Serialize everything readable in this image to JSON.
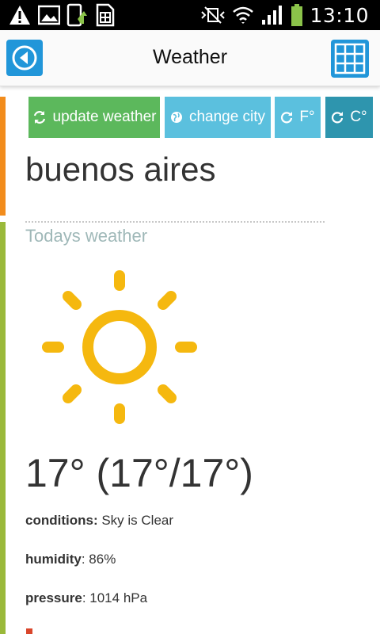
{
  "status_bar": {
    "time": "13:10",
    "left_icons": [
      "warning-icon",
      "image-icon",
      "phone-update-icon",
      "sim-card-icon"
    ],
    "right_icons": [
      "vibrate-off-icon",
      "wifi-icon",
      "signal-icon",
      "battery-icon"
    ],
    "battery_color": "#8bc34a"
  },
  "titlebar": {
    "title": "Weather",
    "back_icon": "back-arrow-icon",
    "menu_icon": "grid-icon",
    "accent": "#2196d9"
  },
  "actions": {
    "update_label": "update weather",
    "city_label": "change city",
    "f_label": "F°",
    "c_label": "C°"
  },
  "city": "buenos aires",
  "section_title": "Todays weather",
  "weather_icon": "sun-icon",
  "temperature": "17° (17°/17°)",
  "details": {
    "conditions_label": "conditions:",
    "conditions_value": " Sky is Clear",
    "humidity_label": "humidity",
    "humidity_value": ": 86%",
    "pressure_label": "pressure",
    "pressure_value": ": 1014 hPa"
  },
  "colors": {
    "orange_accent": "#f28c1c",
    "green_accent": "#9ab93a",
    "update_button": "#5cb85c",
    "info_button": "#5bc0de",
    "active_button": "#2e95ae",
    "sun": "#f5b80f"
  }
}
